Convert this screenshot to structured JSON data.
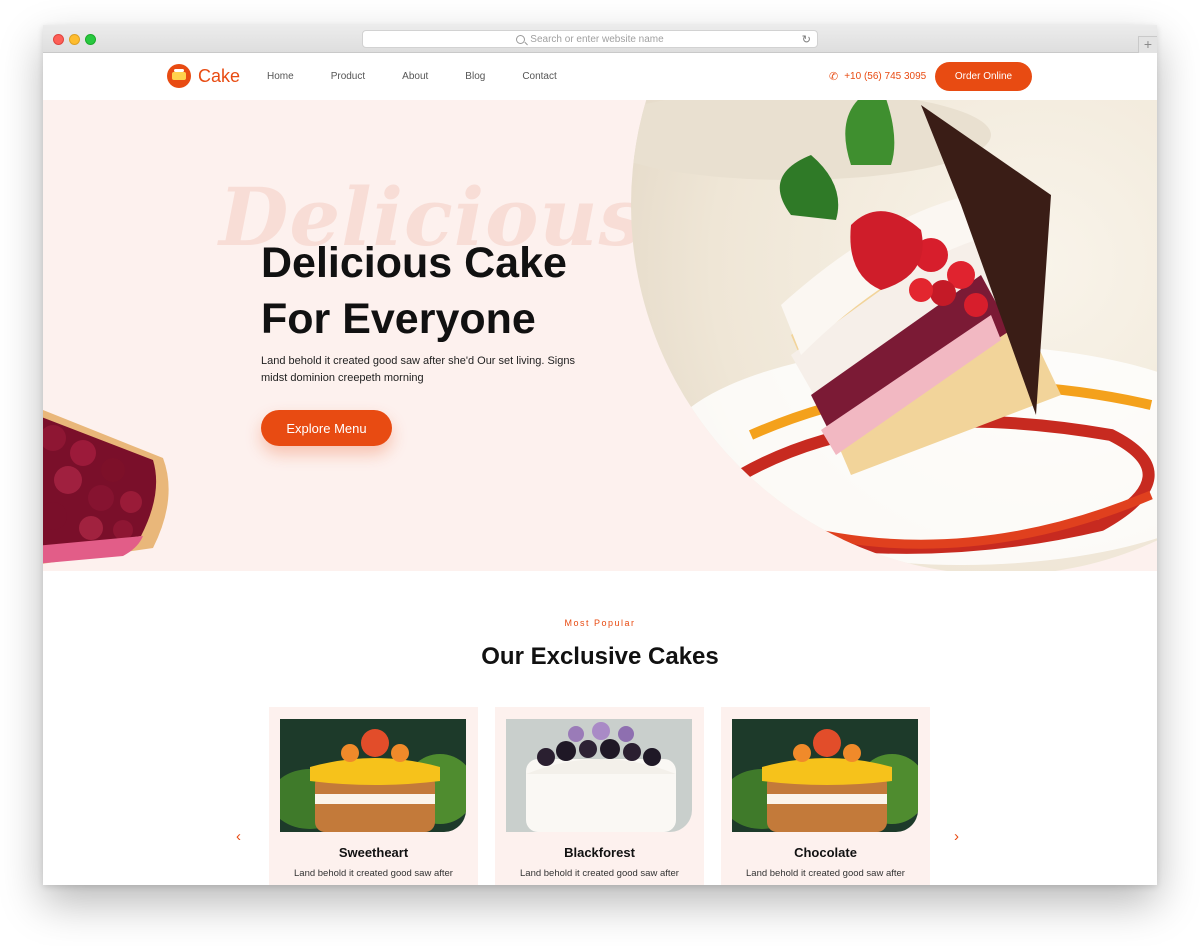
{
  "browser": {
    "url_placeholder": "Search or enter website name",
    "new_tab": "+"
  },
  "nav": {
    "logo_text": "Cake",
    "menu": [
      {
        "label": "Home"
      },
      {
        "label": "Product"
      },
      {
        "label": "About"
      },
      {
        "label": "Blog"
      },
      {
        "label": "Contact"
      }
    ],
    "phone": "+10 (56) 745 3095",
    "order_label": "Order Online"
  },
  "hero": {
    "bg_word": "Delicious",
    "title": "Delicious Cake For Everyone",
    "text": "Land behold it created good saw after she'd Our set living. Signs midst dominion creepeth morning",
    "button_label": "Explore Menu"
  },
  "section": {
    "kicker": "Most Popular",
    "title": "Our Exclusive Cakes",
    "prev": "‹",
    "next": "›",
    "cards": [
      {
        "name": "Sweetheart",
        "desc": "Land behold it created good saw after she'd our set."
      },
      {
        "name": "Blackforest",
        "desc": "Land behold it created good saw after she'd our set."
      },
      {
        "name": "Chocolate",
        "desc": "Land behold it created good saw after she'd our set."
      }
    ]
  },
  "colors": {
    "accent": "#e84b12",
    "hero_bg": "#fdf1ee",
    "card_bg": "#fdf1ee"
  }
}
